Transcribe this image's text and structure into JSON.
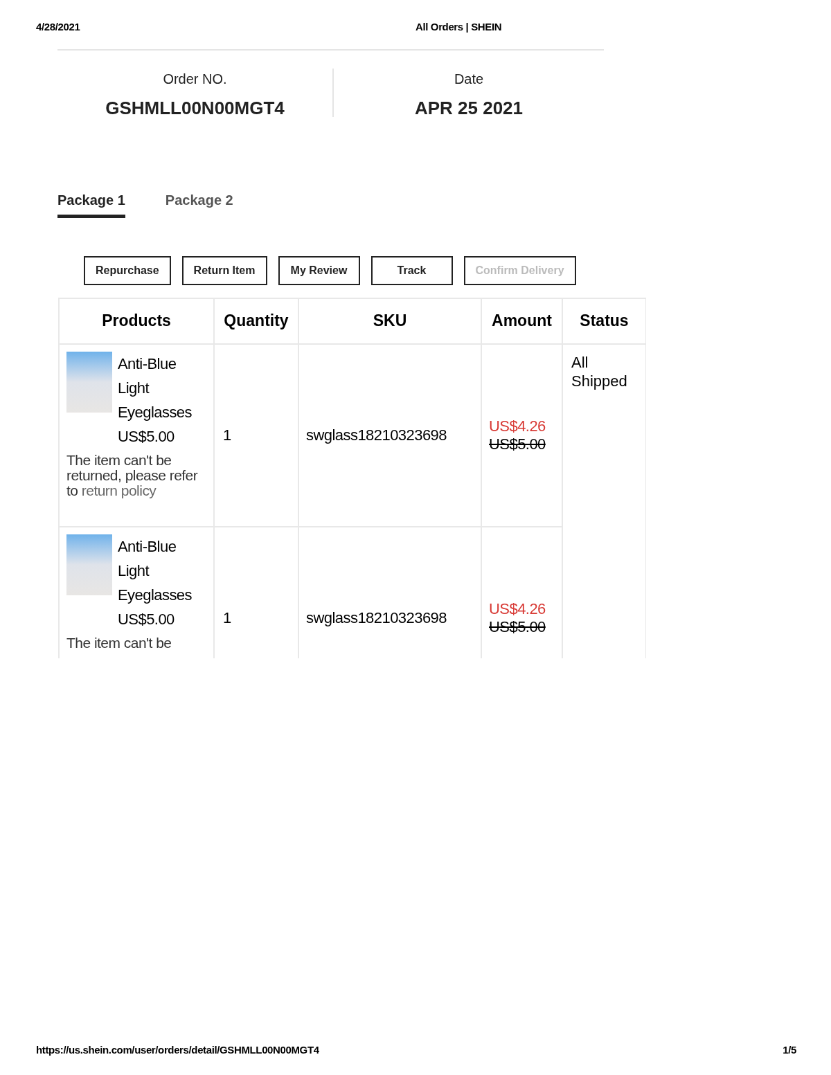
{
  "print_header": {
    "date": "4/28/2021",
    "title": "All Orders | SHEIN"
  },
  "order": {
    "number_label": "Order NO.",
    "number": "GSHMLL00N00MGT4",
    "date_label": "Date",
    "date": "APR 25 2021"
  },
  "tabs": [
    {
      "label": "Package 1",
      "selected": true
    },
    {
      "label": "Package 2",
      "selected": false
    }
  ],
  "actions": [
    {
      "label": "Repurchase",
      "disabled": false
    },
    {
      "label": "Return Item",
      "disabled": false
    },
    {
      "label": "My Review",
      "disabled": false
    },
    {
      "label": "Track",
      "disabled": false
    },
    {
      "label": "Confirm Delivery",
      "disabled": true
    }
  ],
  "table": {
    "columns": [
      "Products",
      "Quantity",
      "SKU",
      "Amount",
      "Status"
    ],
    "status": "All Shipped",
    "rows": [
      {
        "name": "Anti-Blue Light Eyeglasses",
        "price": "US$5.00",
        "note": "The item can't be returned, please refer to",
        "note_link": "return policy",
        "quantity": "1",
        "sku": "swglass18210323698",
        "sale_price": "US$4.26",
        "original_price": "US$5.00"
      },
      {
        "name": "Anti-Blue Light Eyeglasses",
        "price": "US$5.00",
        "note": "The item can't be",
        "quantity": "1",
        "sku": "swglass18210323698",
        "sale_price": "US$4.26",
        "original_price": "US$5.00"
      }
    ]
  },
  "print_footer": {
    "url": "https://us.shein.com/user/orders/detail/GSHMLL00N00MGT4",
    "page": "1/5"
  }
}
